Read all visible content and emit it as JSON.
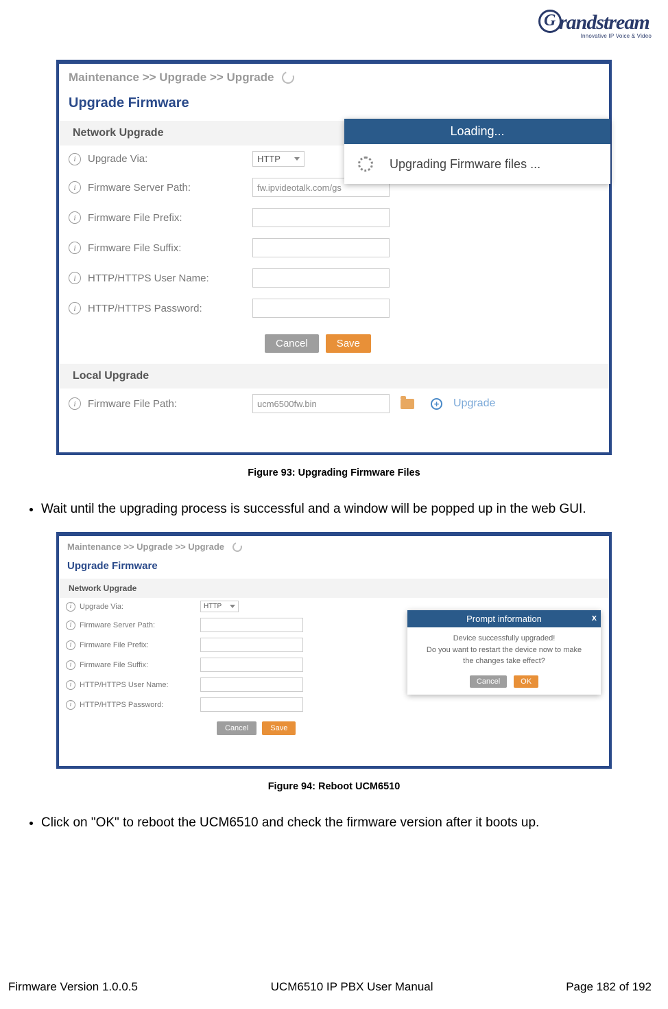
{
  "logo": {
    "brand": "randstream",
    "tagline": "Innovative IP Voice & Video"
  },
  "ss1": {
    "breadcrumb": "Maintenance >> Upgrade >> Upgrade",
    "title": "Upgrade Firmware",
    "network_head": "Network Upgrade",
    "fields": {
      "upgrade_via": {
        "label": "Upgrade Via:",
        "value": "HTTP"
      },
      "server_path": {
        "label": "Firmware Server Path:",
        "value": "fw.ipvideotalk.com/gs"
      },
      "prefix": {
        "label": "Firmware File Prefix:",
        "value": ""
      },
      "suffix": {
        "label": "Firmware File Suffix:",
        "value": ""
      },
      "user": {
        "label": "HTTP/HTTPS User Name:",
        "value": ""
      },
      "pass": {
        "label": "HTTP/HTTPS Password:",
        "value": ""
      }
    },
    "buttons": {
      "cancel": "Cancel",
      "save": "Save"
    },
    "local_head": "Local Upgrade",
    "file_path": {
      "label": "Firmware File Path:",
      "value": "ucm6500fw.bin"
    },
    "upgrade_link": "Upgrade",
    "loading": {
      "header": "Loading...",
      "body": "Upgrading Firmware files ..."
    }
  },
  "caption1": "Figure 93: Upgrading Firmware Files",
  "bullet1": "Wait until the upgrading process is successful and a window will be popped up in the web GUI.",
  "ss2": {
    "breadcrumb": "Maintenance >> Upgrade >> Upgrade",
    "title": "Upgrade Firmware",
    "network_head": "Network Upgrade",
    "fields": {
      "upgrade_via": {
        "label": "Upgrade Via:",
        "value": "HTTP"
      },
      "server_path": {
        "label": "Firmware Server Path:",
        "value": ""
      },
      "prefix": {
        "label": "Firmware File Prefix:",
        "value": ""
      },
      "suffix": {
        "label": "Firmware File Suffix:",
        "value": ""
      },
      "user": {
        "label": "HTTP/HTTPS User Name:",
        "value": ""
      },
      "pass": {
        "label": "HTTP/HTTPS Password:",
        "value": ""
      }
    },
    "buttons": {
      "cancel": "Cancel",
      "save": "Save"
    },
    "prompt": {
      "header": "Prompt information",
      "line1": "Device successfully upgraded!",
      "line2": "Do you want to restart the device now to make",
      "line3": "the changes take effect?",
      "cancel": "Cancel",
      "ok": "OK"
    }
  },
  "caption2": "Figure 94: Reboot UCM6510",
  "bullet2": "Click on \"OK\" to reboot the UCM6510 and check the firmware version after it boots up.",
  "footer": {
    "left": "Firmware Version 1.0.0.5",
    "center": "UCM6510 IP PBX User Manual",
    "right": "Page 182 of 192"
  }
}
